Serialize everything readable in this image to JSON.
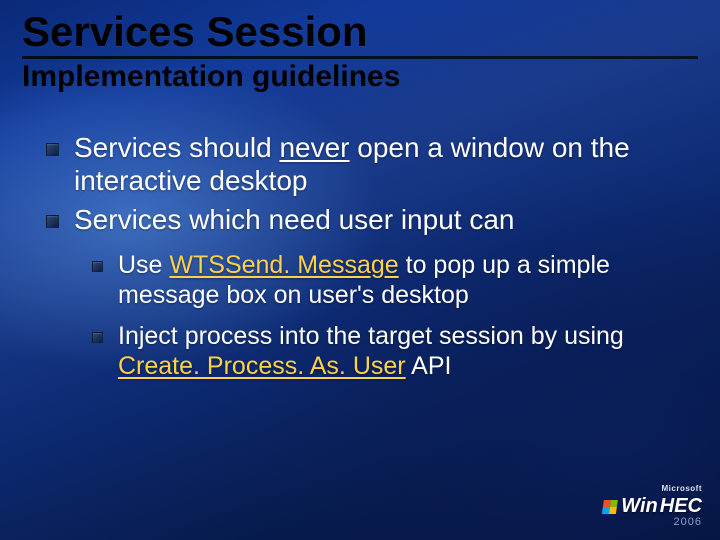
{
  "title": "Services Session",
  "subtitle": "Implementation guidelines",
  "bullets": {
    "b1_pre": "Services should ",
    "b1_u": "never",
    "b1_post": " open a window on the interactive desktop",
    "b2": "Services which need user input can",
    "b2a_pre": "Use ",
    "b2a_api": "WTSSend. Message",
    "b2a_post": " to pop up a simple message box on user's desktop",
    "b2b_pre": "Inject process into the target session by using ",
    "b2b_api": "Create. Process. As. User",
    "b2b_post": " API"
  },
  "footer": {
    "ms": "Microsoft",
    "brand_win": "Win",
    "brand_hec": "HEC",
    "year": "2006"
  }
}
